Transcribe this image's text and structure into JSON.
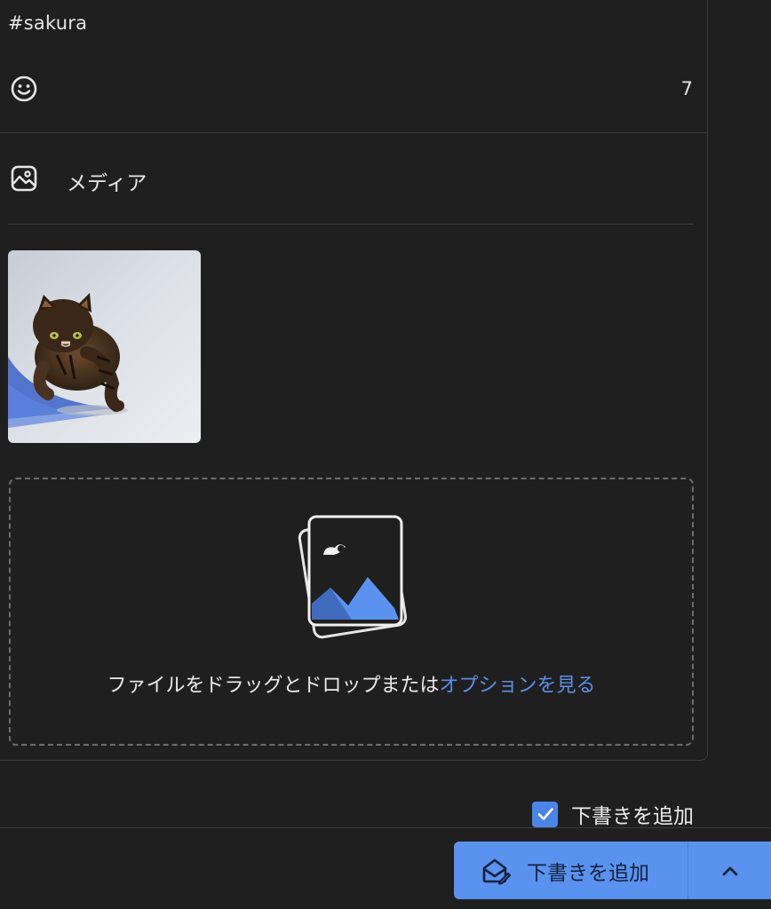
{
  "composer": {
    "hashtag_text": "#sakura",
    "char_count": "7"
  },
  "media": {
    "label": "メディア",
    "thumbnail_alt": "snow cat"
  },
  "dropzone": {
    "text": "ファイルをドラッグとドロップまたは",
    "link": "オプションを見る"
  },
  "footer": {
    "draft_checkbox_label": "下書きを追加",
    "draft_checked": true,
    "primary_button_label": "下書きを追加"
  },
  "colors": {
    "accent": "#5a93ef",
    "link": "#5a8fe8",
    "background": "#1f1f1f"
  },
  "icons": {
    "emoji": "smiley-icon",
    "media": "image-icon",
    "button": "envelope-edit-icon",
    "caret": "chevron-up-icon"
  }
}
